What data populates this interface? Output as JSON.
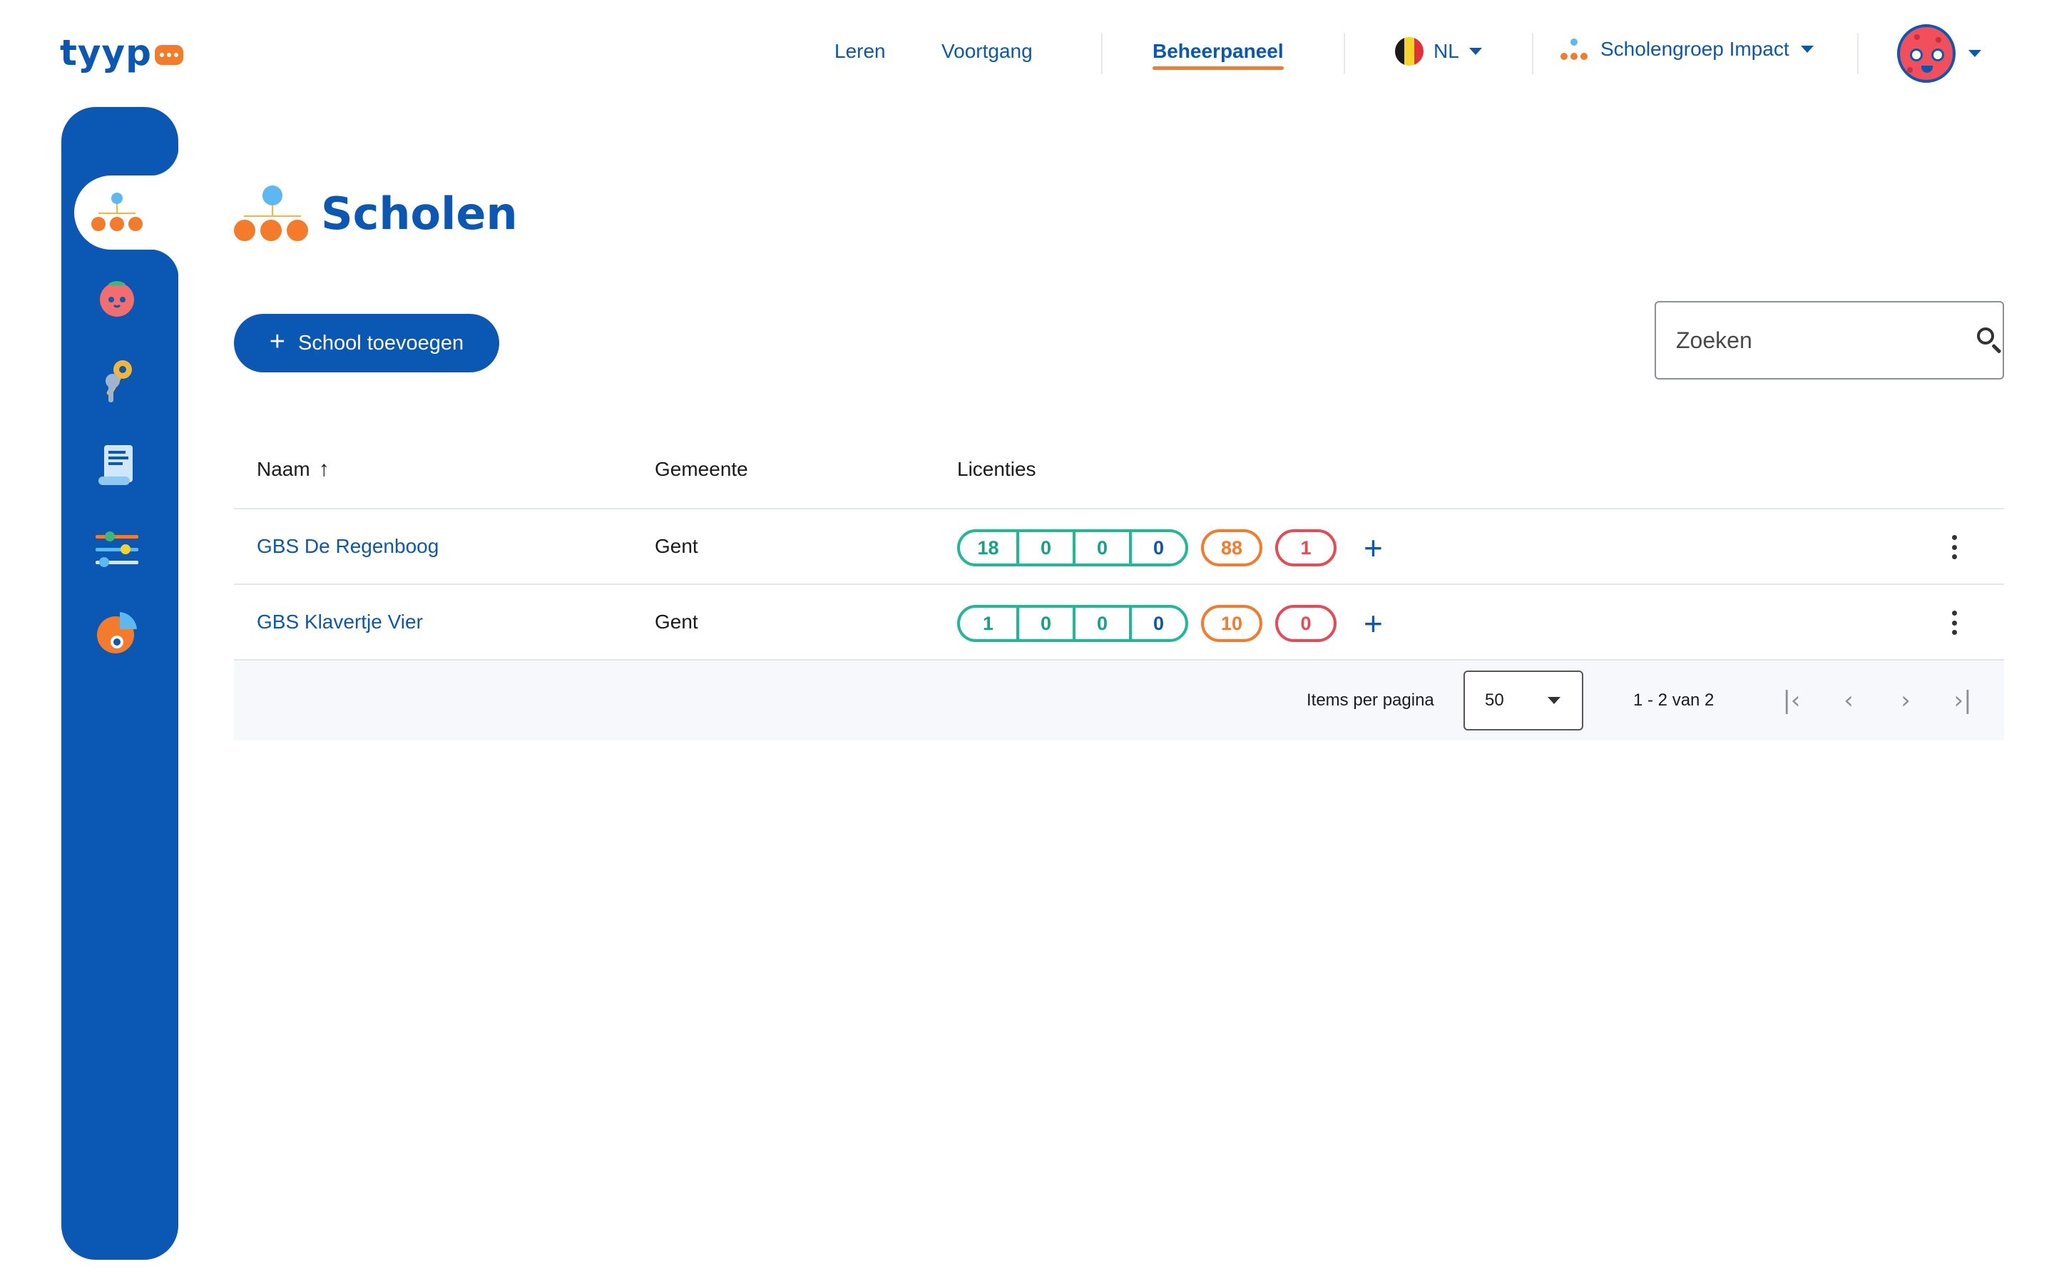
{
  "brand": {
    "name": "tyyp"
  },
  "nav": {
    "links": [
      "Leren",
      "Voortgang",
      "Beheerpaneel"
    ],
    "active": "Beheerpaneel",
    "language": "NL",
    "organization": "Scholengroep Impact"
  },
  "sidebar": {
    "items": [
      {
        "icon": "school-tree-icon",
        "active": true
      },
      {
        "icon": "tomato-character-icon",
        "active": false
      },
      {
        "icon": "keys-icon",
        "active": false
      },
      {
        "icon": "receipt-scroll-icon",
        "active": false
      },
      {
        "icon": "sliders-icon",
        "active": false
      },
      {
        "icon": "pie-chart-icon",
        "active": false
      }
    ]
  },
  "page": {
    "title": "Scholen",
    "add_button": "School toevoegen",
    "search_placeholder": "Zoeken"
  },
  "table": {
    "headers": {
      "naam": "Naam",
      "gemeente": "Gemeente",
      "licenties": "Licenties"
    },
    "sort": {
      "column": "naam",
      "direction": "asc"
    },
    "rows": [
      {
        "naam": "GBS De Regenboog",
        "gemeente": "Gent",
        "licenties": {
          "group": [
            "18",
            "0",
            "0",
            "0"
          ],
          "orange": "88",
          "red": "1"
        }
      },
      {
        "naam": "GBS Klavertje Vier",
        "gemeente": "Gent",
        "licenties": {
          "group": [
            "1",
            "0",
            "0",
            "0"
          ],
          "orange": "10",
          "red": "0"
        }
      }
    ]
  },
  "paginator": {
    "label": "Items per pagina",
    "page_size": "50",
    "range": "1 - 2 van 2"
  },
  "colors": {
    "primary": "#0a57b4",
    "accent": "#f47b2a",
    "green": "#1fb996",
    "red": "#e84a55"
  }
}
